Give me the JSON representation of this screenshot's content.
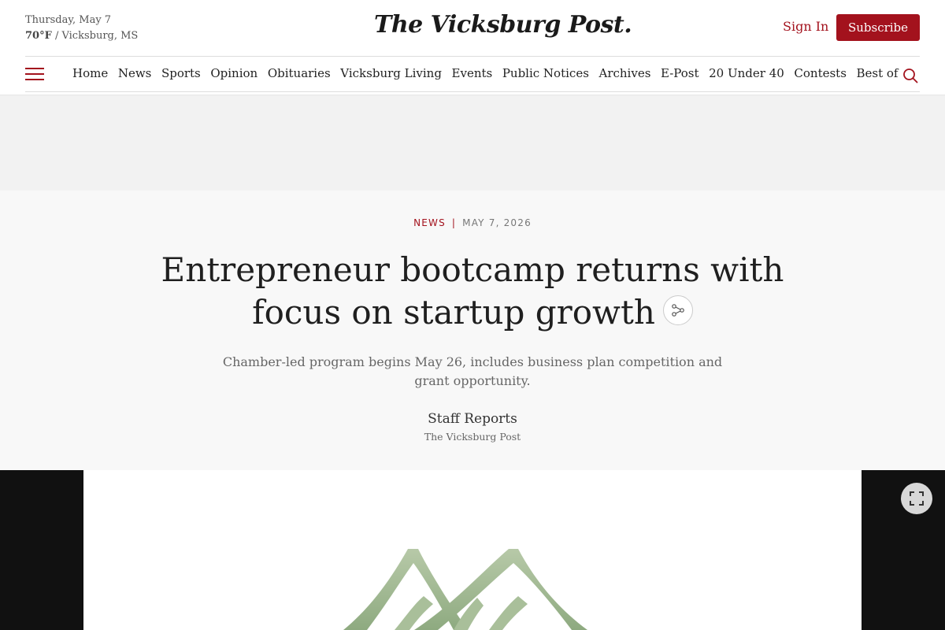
{
  "header": {
    "date": "Thursday, May 7",
    "temperature": "70°F",
    "location": " / Vicksburg, MS",
    "masthead": "The Vicksburg Post.",
    "sign_in": "Sign In",
    "subscribe": "Subscribe"
  },
  "nav": {
    "items": [
      "Home",
      "News",
      "Sports",
      "Opinion",
      "Obituaries",
      "Vicksburg Living",
      "Events",
      "Public Notices",
      "Archives",
      "E-Post",
      "20 Under 40",
      "Contests",
      "Best of"
    ]
  },
  "article": {
    "category": "NEWS",
    "date": "MAY 7, 2026",
    "headline": "Entrepreneur bootcamp returns with focus on startup growth",
    "subheadline": "Chamber-led program begins May 26, includes business plan competition and grant opportunity.",
    "author": "Staff Reports",
    "publication": "The Vicksburg Post"
  },
  "colors": {
    "accent": "#a3121d",
    "logo_green": "#9db58f"
  }
}
